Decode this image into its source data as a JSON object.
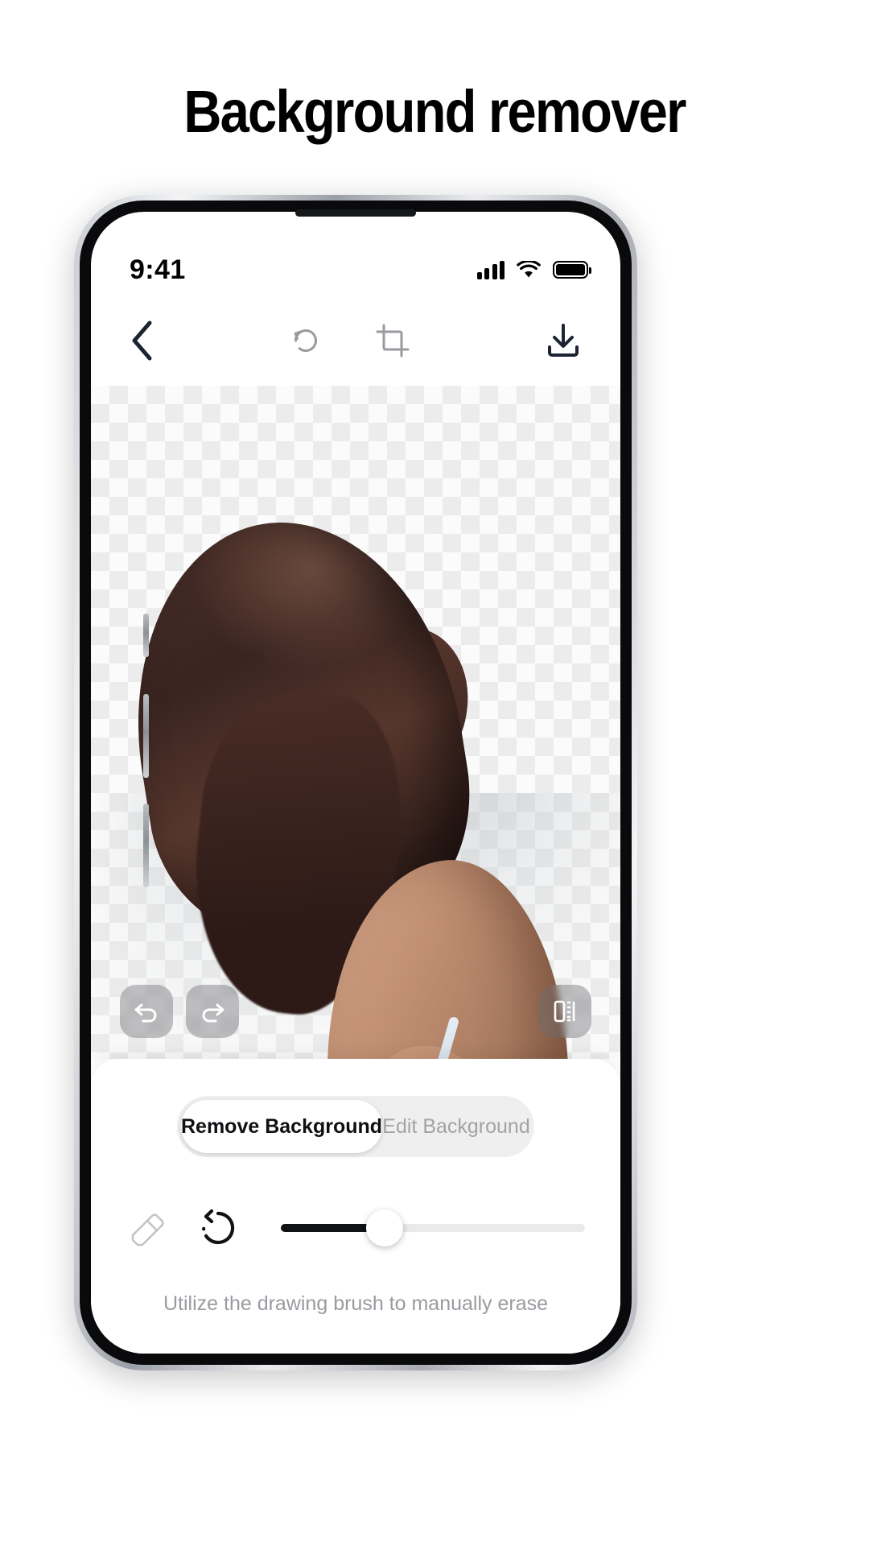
{
  "page": {
    "title": "Background remover",
    "background_color": "#ffffff"
  },
  "phone": {
    "status_bar": {
      "time": "9:41",
      "cellular_icon": "cellular-signal-icon",
      "wifi_icon": "wifi-icon",
      "battery_icon": "battery-full-icon",
      "battery_level": 100
    },
    "toolbar": {
      "back_icon": "chevron-left-icon",
      "reset_icon": "rotate-reset-icon",
      "crop_icon": "crop-icon",
      "download_icon": "download-icon",
      "back_color": "#1c2333",
      "tool_color": "#9a9aa0"
    },
    "canvas": {
      "transparency_pattern": "checkerboard",
      "checker_color": "#ececec",
      "controls": {
        "undo_icon": "undo-arrow-icon",
        "redo_icon": "redo-arrow-icon",
        "compare_icon": "compare-split-icon",
        "button_background": "#6e6e73"
      }
    },
    "sheet": {
      "tabs": [
        {
          "label": "Remove Background",
          "active": true
        },
        {
          "label": "Edit Background",
          "active": false
        }
      ],
      "tools": {
        "eraser_icon": "eraser-icon",
        "restore_icon": "restore-dotted-arrow-icon",
        "eraser_color": "#c4c4c8",
        "restore_color": "#111214"
      },
      "slider": {
        "label": "brush-size",
        "value_percent": 34,
        "fill_color": "#111214",
        "track_color": "#eaeaea",
        "thumb_color": "#ffffff"
      },
      "hint": "Utilize the drawing brush to manually erase"
    }
  }
}
